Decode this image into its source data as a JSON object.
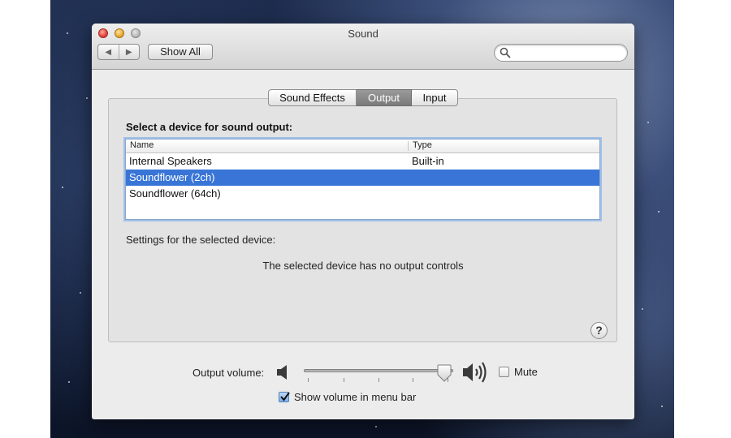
{
  "window": {
    "title": "Sound"
  },
  "toolbar": {
    "back_glyph": "◀",
    "forward_glyph": "▶",
    "show_all_label": "Show All",
    "search_placeholder": "",
    "search_value": ""
  },
  "tabs": [
    {
      "label": "Sound Effects",
      "active": false
    },
    {
      "label": "Output",
      "active": true
    },
    {
      "label": "Input",
      "active": false
    }
  ],
  "output": {
    "heading": "Select a device for sound output:",
    "columns": {
      "name": "Name",
      "type": "Type"
    },
    "devices": [
      {
        "name": "Internal Speakers",
        "type": "Built-in",
        "selected": false
      },
      {
        "name": "Soundflower (2ch)",
        "type": "",
        "selected": true
      },
      {
        "name": "Soundflower (64ch)",
        "type": "",
        "selected": false
      }
    ],
    "settings_label": "Settings for the selected device:",
    "no_controls_text": "The selected device has no output controls"
  },
  "help_glyph": "?",
  "volume": {
    "label": "Output volume:",
    "level": 0.94,
    "mute_label": "Mute",
    "mute_checked": false,
    "show_in_menu_bar_label": "Show volume in menu bar",
    "show_in_menu_bar_checked": true
  },
  "colors": {
    "selection": "#3875d7",
    "active_tab": "#7a7a7a",
    "window_bg": "#ececec"
  },
  "icons": [
    "search-icon",
    "speaker-low-icon",
    "speaker-high-icon",
    "checkmark-icon",
    "back-arrow-icon",
    "forward-arrow-icon"
  ]
}
